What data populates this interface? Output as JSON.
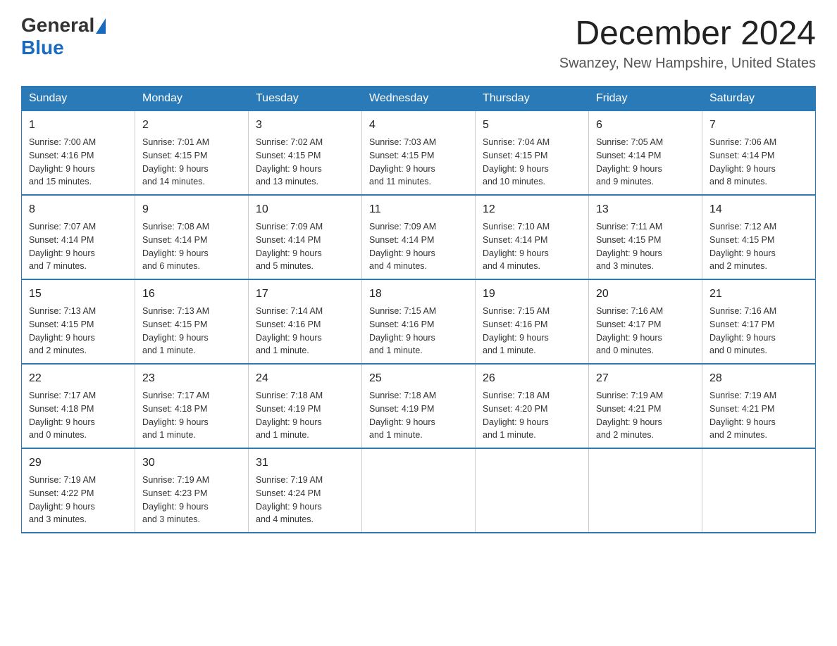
{
  "header": {
    "logo_general": "General",
    "logo_blue": "Blue",
    "month_title": "December 2024",
    "location": "Swanzey, New Hampshire, United States"
  },
  "days_of_week": [
    "Sunday",
    "Monday",
    "Tuesday",
    "Wednesday",
    "Thursday",
    "Friday",
    "Saturday"
  ],
  "weeks": [
    [
      {
        "day": "1",
        "sunrise": "7:00 AM",
        "sunset": "4:16 PM",
        "daylight": "9 hours and 15 minutes."
      },
      {
        "day": "2",
        "sunrise": "7:01 AM",
        "sunset": "4:15 PM",
        "daylight": "9 hours and 14 minutes."
      },
      {
        "day": "3",
        "sunrise": "7:02 AM",
        "sunset": "4:15 PM",
        "daylight": "9 hours and 13 minutes."
      },
      {
        "day": "4",
        "sunrise": "7:03 AM",
        "sunset": "4:15 PM",
        "daylight": "9 hours and 11 minutes."
      },
      {
        "day": "5",
        "sunrise": "7:04 AM",
        "sunset": "4:15 PM",
        "daylight": "9 hours and 10 minutes."
      },
      {
        "day": "6",
        "sunrise": "7:05 AM",
        "sunset": "4:14 PM",
        "daylight": "9 hours and 9 minutes."
      },
      {
        "day": "7",
        "sunrise": "7:06 AM",
        "sunset": "4:14 PM",
        "daylight": "9 hours and 8 minutes."
      }
    ],
    [
      {
        "day": "8",
        "sunrise": "7:07 AM",
        "sunset": "4:14 PM",
        "daylight": "9 hours and 7 minutes."
      },
      {
        "day": "9",
        "sunrise": "7:08 AM",
        "sunset": "4:14 PM",
        "daylight": "9 hours and 6 minutes."
      },
      {
        "day": "10",
        "sunrise": "7:09 AM",
        "sunset": "4:14 PM",
        "daylight": "9 hours and 5 minutes."
      },
      {
        "day": "11",
        "sunrise": "7:09 AM",
        "sunset": "4:14 PM",
        "daylight": "9 hours and 4 minutes."
      },
      {
        "day": "12",
        "sunrise": "7:10 AM",
        "sunset": "4:14 PM",
        "daylight": "9 hours and 4 minutes."
      },
      {
        "day": "13",
        "sunrise": "7:11 AM",
        "sunset": "4:15 PM",
        "daylight": "9 hours and 3 minutes."
      },
      {
        "day": "14",
        "sunrise": "7:12 AM",
        "sunset": "4:15 PM",
        "daylight": "9 hours and 2 minutes."
      }
    ],
    [
      {
        "day": "15",
        "sunrise": "7:13 AM",
        "sunset": "4:15 PM",
        "daylight": "9 hours and 2 minutes."
      },
      {
        "day": "16",
        "sunrise": "7:13 AM",
        "sunset": "4:15 PM",
        "daylight": "9 hours and 1 minute."
      },
      {
        "day": "17",
        "sunrise": "7:14 AM",
        "sunset": "4:16 PM",
        "daylight": "9 hours and 1 minute."
      },
      {
        "day": "18",
        "sunrise": "7:15 AM",
        "sunset": "4:16 PM",
        "daylight": "9 hours and 1 minute."
      },
      {
        "day": "19",
        "sunrise": "7:15 AM",
        "sunset": "4:16 PM",
        "daylight": "9 hours and 1 minute."
      },
      {
        "day": "20",
        "sunrise": "7:16 AM",
        "sunset": "4:17 PM",
        "daylight": "9 hours and 0 minutes."
      },
      {
        "day": "21",
        "sunrise": "7:16 AM",
        "sunset": "4:17 PM",
        "daylight": "9 hours and 0 minutes."
      }
    ],
    [
      {
        "day": "22",
        "sunrise": "7:17 AM",
        "sunset": "4:18 PM",
        "daylight": "9 hours and 0 minutes."
      },
      {
        "day": "23",
        "sunrise": "7:17 AM",
        "sunset": "4:18 PM",
        "daylight": "9 hours and 1 minute."
      },
      {
        "day": "24",
        "sunrise": "7:18 AM",
        "sunset": "4:19 PM",
        "daylight": "9 hours and 1 minute."
      },
      {
        "day": "25",
        "sunrise": "7:18 AM",
        "sunset": "4:19 PM",
        "daylight": "9 hours and 1 minute."
      },
      {
        "day": "26",
        "sunrise": "7:18 AM",
        "sunset": "4:20 PM",
        "daylight": "9 hours and 1 minute."
      },
      {
        "day": "27",
        "sunrise": "7:19 AM",
        "sunset": "4:21 PM",
        "daylight": "9 hours and 2 minutes."
      },
      {
        "day": "28",
        "sunrise": "7:19 AM",
        "sunset": "4:21 PM",
        "daylight": "9 hours and 2 minutes."
      }
    ],
    [
      {
        "day": "29",
        "sunrise": "7:19 AM",
        "sunset": "4:22 PM",
        "daylight": "9 hours and 3 minutes."
      },
      {
        "day": "30",
        "sunrise": "7:19 AM",
        "sunset": "4:23 PM",
        "daylight": "9 hours and 3 minutes."
      },
      {
        "day": "31",
        "sunrise": "7:19 AM",
        "sunset": "4:24 PM",
        "daylight": "9 hours and 4 minutes."
      },
      null,
      null,
      null,
      null
    ]
  ],
  "labels": {
    "sunrise_prefix": "Sunrise: ",
    "sunset_prefix": "Sunset: ",
    "daylight_prefix": "Daylight: "
  }
}
